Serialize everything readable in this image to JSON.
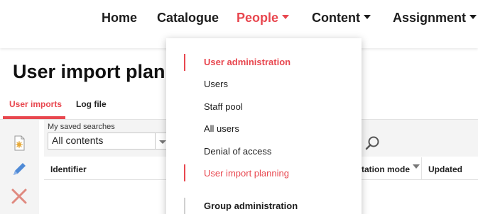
{
  "nav": {
    "home": "Home",
    "catalogue": "Catalogue",
    "people": "People",
    "content": "Content",
    "assignment": "Assignment"
  },
  "page": {
    "title": "User import plann"
  },
  "tabs": {
    "user_imports": "User imports",
    "log_file": "Log file"
  },
  "filters": {
    "saved_searches_label": "My saved searches",
    "saved_searches_value": "All contents"
  },
  "table": {
    "columns": {
      "identifier": "Identifier",
      "mode": "tation mode",
      "updated": "Updated"
    }
  },
  "people_menu": {
    "section_user_admin": "User administration",
    "users": "Users",
    "staff_pool": "Staff pool",
    "all_users": "All users",
    "denial_of_access": "Denial of access",
    "user_import_planning": "User import planning",
    "section_group_admin": "Group administration"
  },
  "colors": {
    "accent": "#e8474f",
    "panel_bg": "#f4f4f4",
    "edit_icon": "#4f8ad6",
    "delete_icon": "#e08a80",
    "add_icon": "#e6a93a"
  },
  "icons": {
    "add": "new-document-icon",
    "edit": "pencil-icon",
    "delete": "x-icon",
    "search": "magnifier-icon"
  }
}
